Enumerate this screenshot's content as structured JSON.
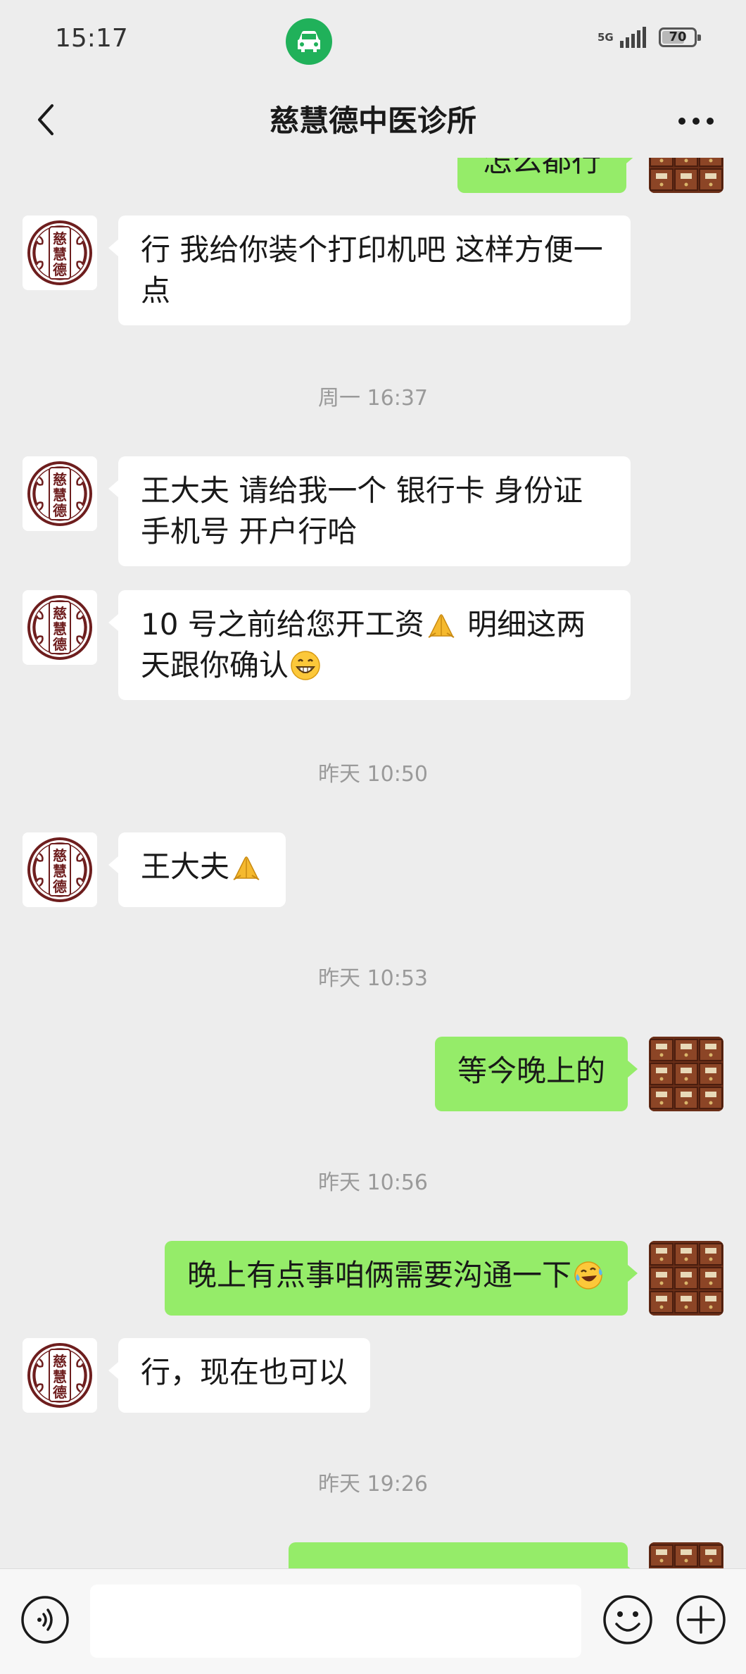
{
  "status_bar": {
    "time": "15:17",
    "network": "5G",
    "battery": "70",
    "battery_level": 0.7,
    "app_icon": "car-icon"
  },
  "header": {
    "title": "慈慧德中医诊所",
    "back_icon": "chevron-left-icon",
    "more_icon": "more-dots-icon"
  },
  "avatars": {
    "contact_seal_text": "慈慧德",
    "self_icon": "medicine-cabinet-photo"
  },
  "messages": [
    {
      "type": "out",
      "text": "怎么都行",
      "partial": true
    },
    {
      "type": "in",
      "text": "行 我给你装个打印机吧 这样方便一点"
    },
    {
      "type": "time",
      "text": "周一 16:37"
    },
    {
      "type": "in",
      "text": "王大夫 请给我一个 银行卡 身份证 手机号 开户行哈"
    },
    {
      "type": "in",
      "text": "10 号之前给您开工资",
      "emoji_1": "folded-hands-emoji",
      "text_2": " 明细这两天跟你确认",
      "emoji_2": "grinning-face-emoji"
    },
    {
      "type": "time",
      "text": "昨天 10:50"
    },
    {
      "type": "in",
      "text": "王大夫",
      "emoji_1": "folded-hands-emoji"
    },
    {
      "type": "time",
      "text": "昨天 10:53"
    },
    {
      "type": "out",
      "text": "等今晚上的"
    },
    {
      "type": "time",
      "text": "昨天 10:56"
    },
    {
      "type": "out",
      "text": "晚上有点事咱俩需要沟通一下",
      "emoji_1": "laughing-tears-emoji"
    },
    {
      "type": "in",
      "text": "行，现在也可以"
    },
    {
      "type": "time",
      "text": "昨天 19:26"
    },
    {
      "type": "out",
      "text": "",
      "partial": true
    }
  ],
  "input_bar": {
    "voice_icon": "voice-icon",
    "emoji_icon": "smiley-icon",
    "plus_icon": "plus-icon",
    "text": ""
  },
  "colors": {
    "background": "#ededed",
    "bubble_in": "#ffffff",
    "bubble_out": "#95ec69",
    "timestamp": "#9a9a9a"
  }
}
